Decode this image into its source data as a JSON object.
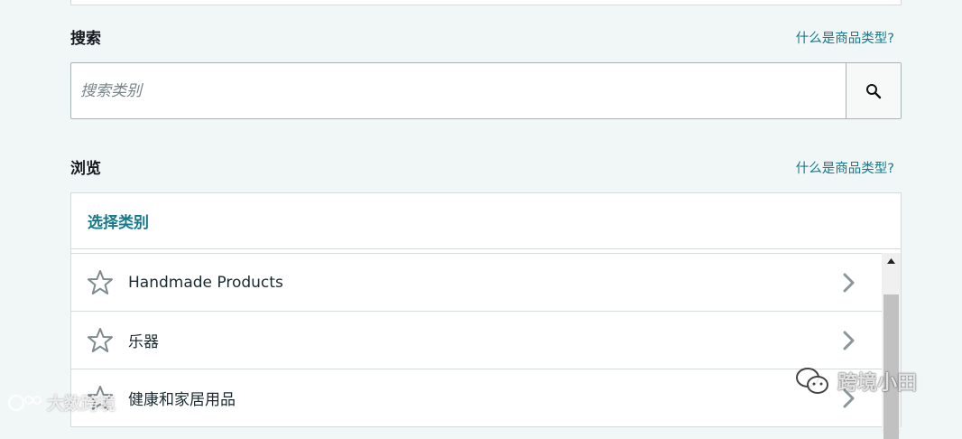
{
  "search": {
    "title": "搜索",
    "help_link": "什么是商品类型?",
    "placeholder": "搜索类别",
    "icon": "search-icon"
  },
  "browse": {
    "title": "浏览",
    "help_link": "什么是商品类型?",
    "panel_header": "选择类别",
    "items": [
      {
        "label": "Handmade Products",
        "icon": "star-icon"
      },
      {
        "label": "乐器",
        "icon": "star-icon"
      },
      {
        "label": "健康和家居用品",
        "icon": "star-icon"
      }
    ]
  },
  "watermarks": {
    "left": "大数跨境",
    "right": "跨境小田"
  },
  "colors": {
    "link": "#167a8b",
    "background": "#f1f6f6",
    "border": "#d5dbdb"
  }
}
